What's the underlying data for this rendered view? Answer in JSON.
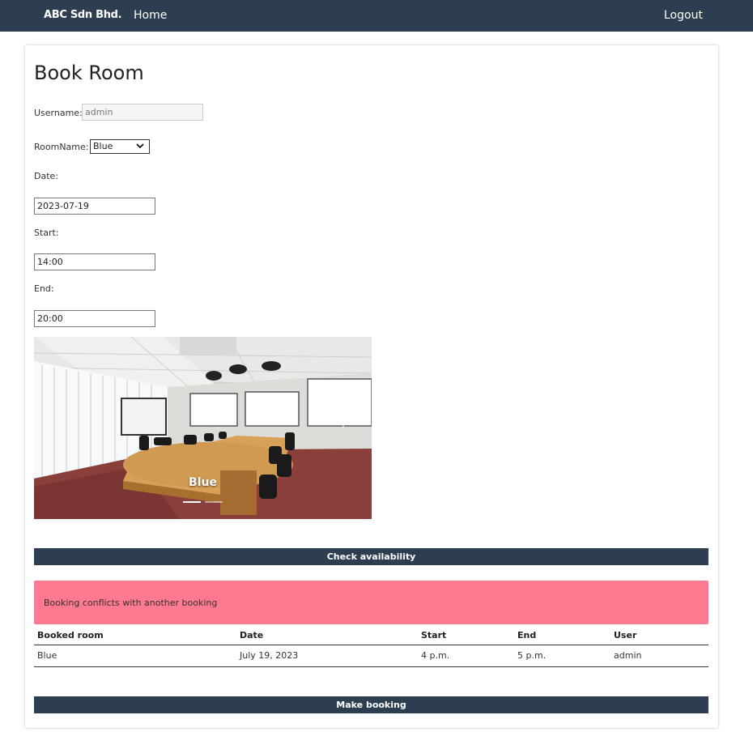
{
  "navbar": {
    "brand": "ABC Sdn Bhd.",
    "home": "Home",
    "logout": "Logout"
  },
  "page": {
    "title": "Book Room"
  },
  "form": {
    "username_label": "Username:",
    "username_value": "admin",
    "roomname_label": "RoomName:",
    "roomname_value": "Blue",
    "date_label": "Date:",
    "date_value": "2023-07-19",
    "start_label": "Start:",
    "start_value": "14:00",
    "end_label": "End:",
    "end_value": "20:00"
  },
  "carousel": {
    "caption": "Blue",
    "slide_count": 2,
    "active_slide": 1
  },
  "buttons": {
    "check": "Check availability",
    "book": "Make booking"
  },
  "alert": {
    "message": "Booking conflicts with another booking"
  },
  "table": {
    "headers": [
      "Booked room",
      "Date",
      "Start",
      "End",
      "User"
    ],
    "rows": [
      [
        "Blue",
        "July 19, 2023",
        "4 p.m.",
        "5 p.m.",
        "admin"
      ]
    ]
  },
  "colors": {
    "navbar": "#2c3e50",
    "alert": "#ff7990"
  }
}
